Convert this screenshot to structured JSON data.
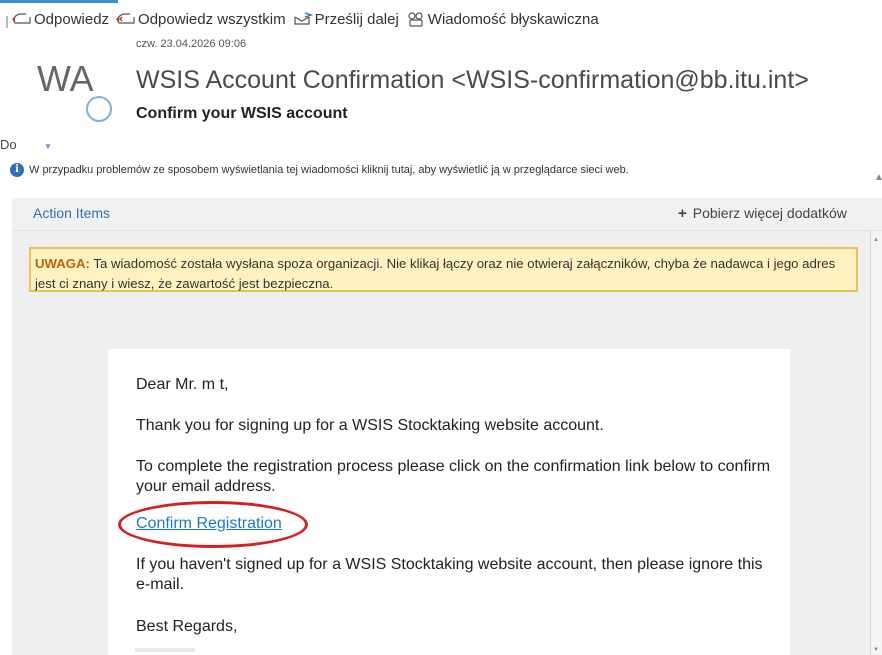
{
  "toolbar": {
    "reply_label": "Odpowiedz",
    "reply_all_label": "Odpowiedz wszystkim",
    "forward_label": "Prześlij dalej",
    "im_label": "Wiadomość błyskawiczna"
  },
  "header": {
    "date": "czw. 23.04.2026 09:06",
    "avatar_initials": "WA",
    "sender": "WSIS Account Confirmation <WSIS-confirmation@bb.itu.int>",
    "subject": "Confirm your WSIS account",
    "to_label": "Do"
  },
  "info_bar": {
    "icon": "info-icon",
    "text": "W przypadku problemów ze sposobem wyświetlania tej wiadomości kliknij tutaj, aby wyświetlić ją w przeglądarce sieci web."
  },
  "action_bar": {
    "action_items_label": "Action Items",
    "get_addins_label": "Pobierz więcej dodatków"
  },
  "warning": {
    "label": "UWAGA:",
    "text": " Ta wiadomość została wysłana spoza organizacji. Nie klikaj łączy oraz nie otwieraj załączników, chyba że nadawca i jego adres jest ci znany i wiesz, że zawartość jest bezpieczna."
  },
  "email_body": {
    "greeting": "Dear Mr. m t,",
    "thanks": "Thank you for signing up for a WSIS Stocktaking website account.",
    "instruction": "To complete the registration process please click on the confirmation link below to confirm your email address.",
    "link_text": "Confirm Registration",
    "ignore_note": "If you haven't signed up for a WSIS Stocktaking website account, then please ignore this e-mail.",
    "closing": "Best Regards,"
  },
  "colors": {
    "accent": "#2f6fb7",
    "warning_bg": "#fff2c0",
    "warning_border": "#e6c455",
    "highlight_circle": "#d42020"
  }
}
